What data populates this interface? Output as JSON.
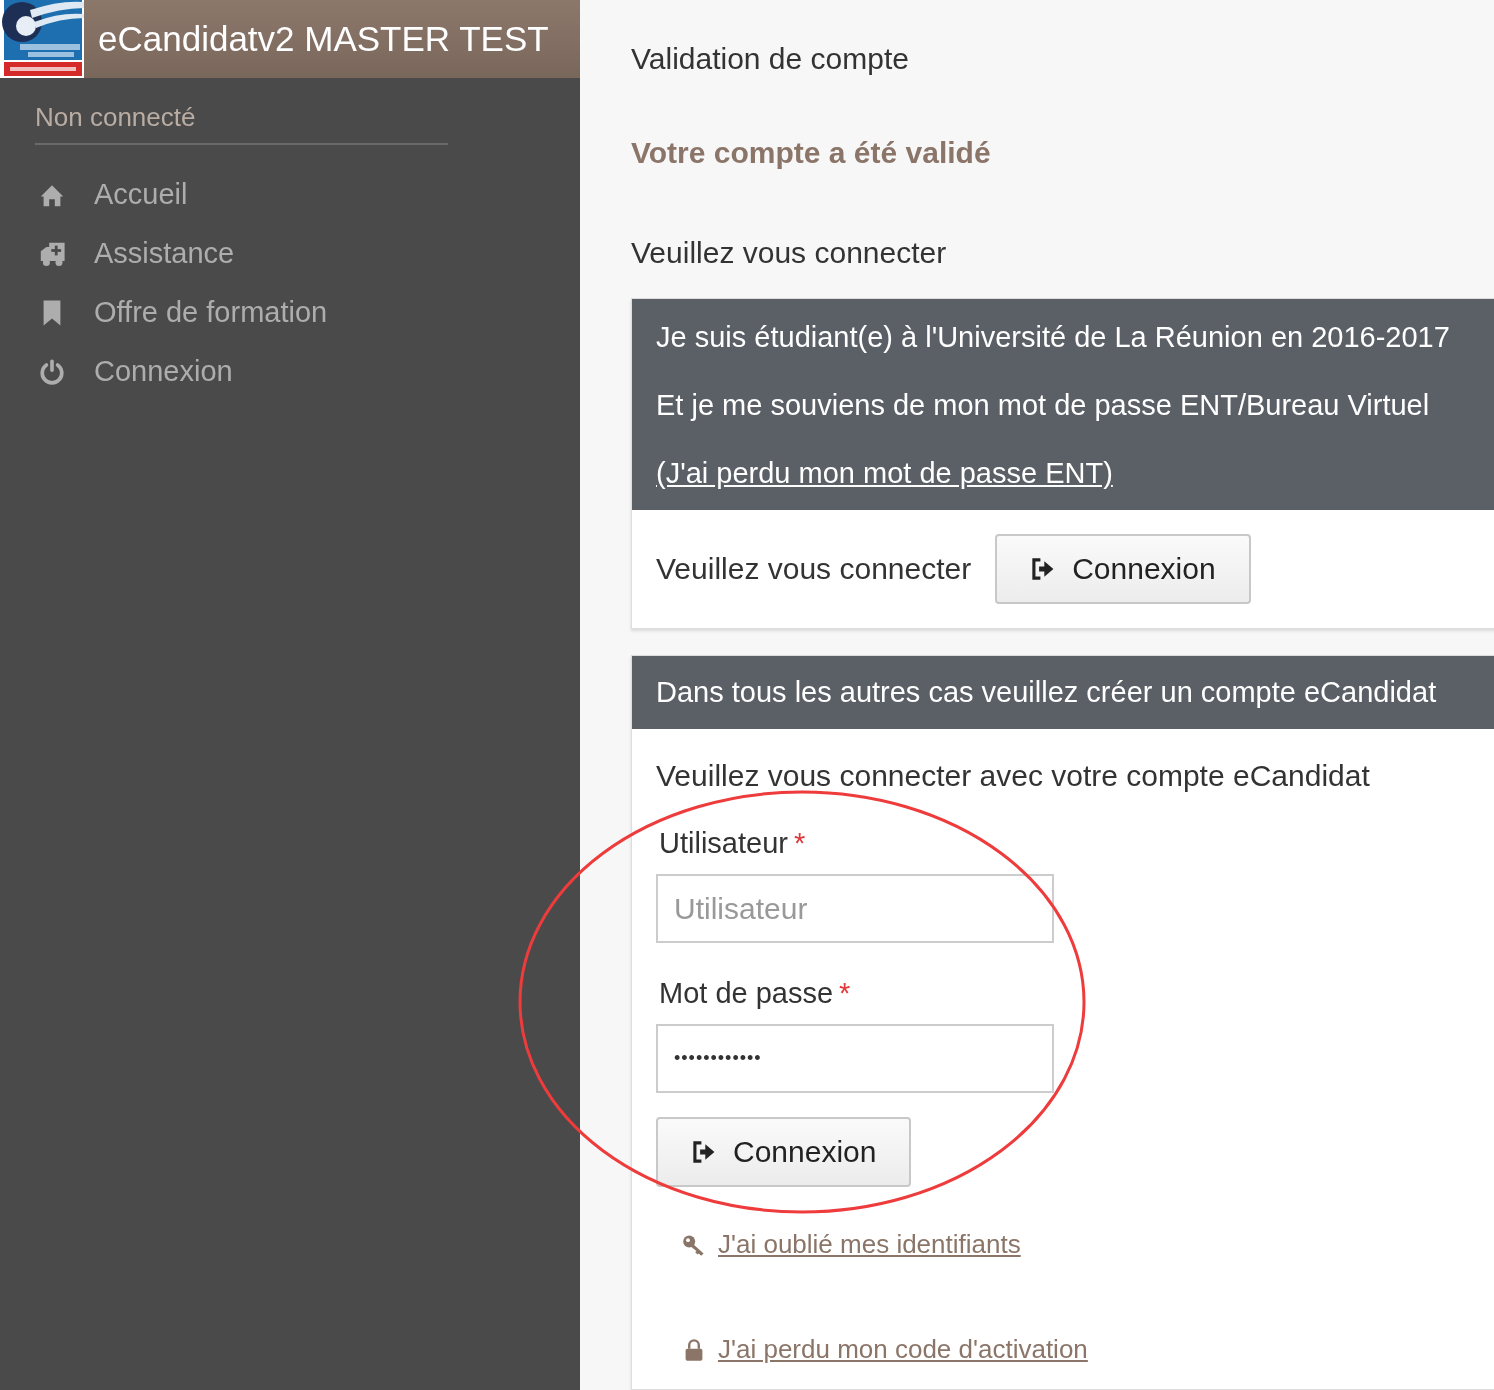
{
  "app": {
    "title": "eCandidatv2 MASTER TEST"
  },
  "sidebar": {
    "status": "Non connecté",
    "items": [
      {
        "kind": "home",
        "label": "Accueil"
      },
      {
        "kind": "ambulance",
        "label": "Assistance"
      },
      {
        "kind": "bookmark",
        "label": "Offre de formation"
      },
      {
        "kind": "power",
        "label": "Connexion"
      }
    ]
  },
  "main": {
    "heading": "Validation de compte",
    "success": "Votre compte a été validé",
    "prompt": "Veuillez vous connecter",
    "ent_panel": {
      "lines": [
        "Je suis étudiant(e) à l'Université de La Réunion en 2016-2017",
        "Et je me souviens de mon mot de passe ENT/Bureau Virtuel"
      ],
      "link": "(J'ai perdu mon mot de passe ENT)",
      "body_text": "Veuillez vous connecter",
      "button": "Connexion"
    },
    "account_panel": {
      "header": "Dans tous les autres cas veuillez créer un compte eCandidat",
      "intro": "Veuillez vous connecter avec votre compte eCandidat",
      "fields": [
        {
          "label": "Utilisateur",
          "required_mark": "*",
          "placeholder": "Utilisateur"
        },
        {
          "label": "Mot de passe",
          "required_mark": "*",
          "value": "••••••••••••"
        }
      ],
      "button": "Connexion",
      "links": [
        {
          "kind": "key",
          "label": "J'ai oublié mes identifiants"
        },
        {
          "kind": "lock",
          "label": "J'ai perdu mon code d'activation"
        }
      ]
    }
  }
}
